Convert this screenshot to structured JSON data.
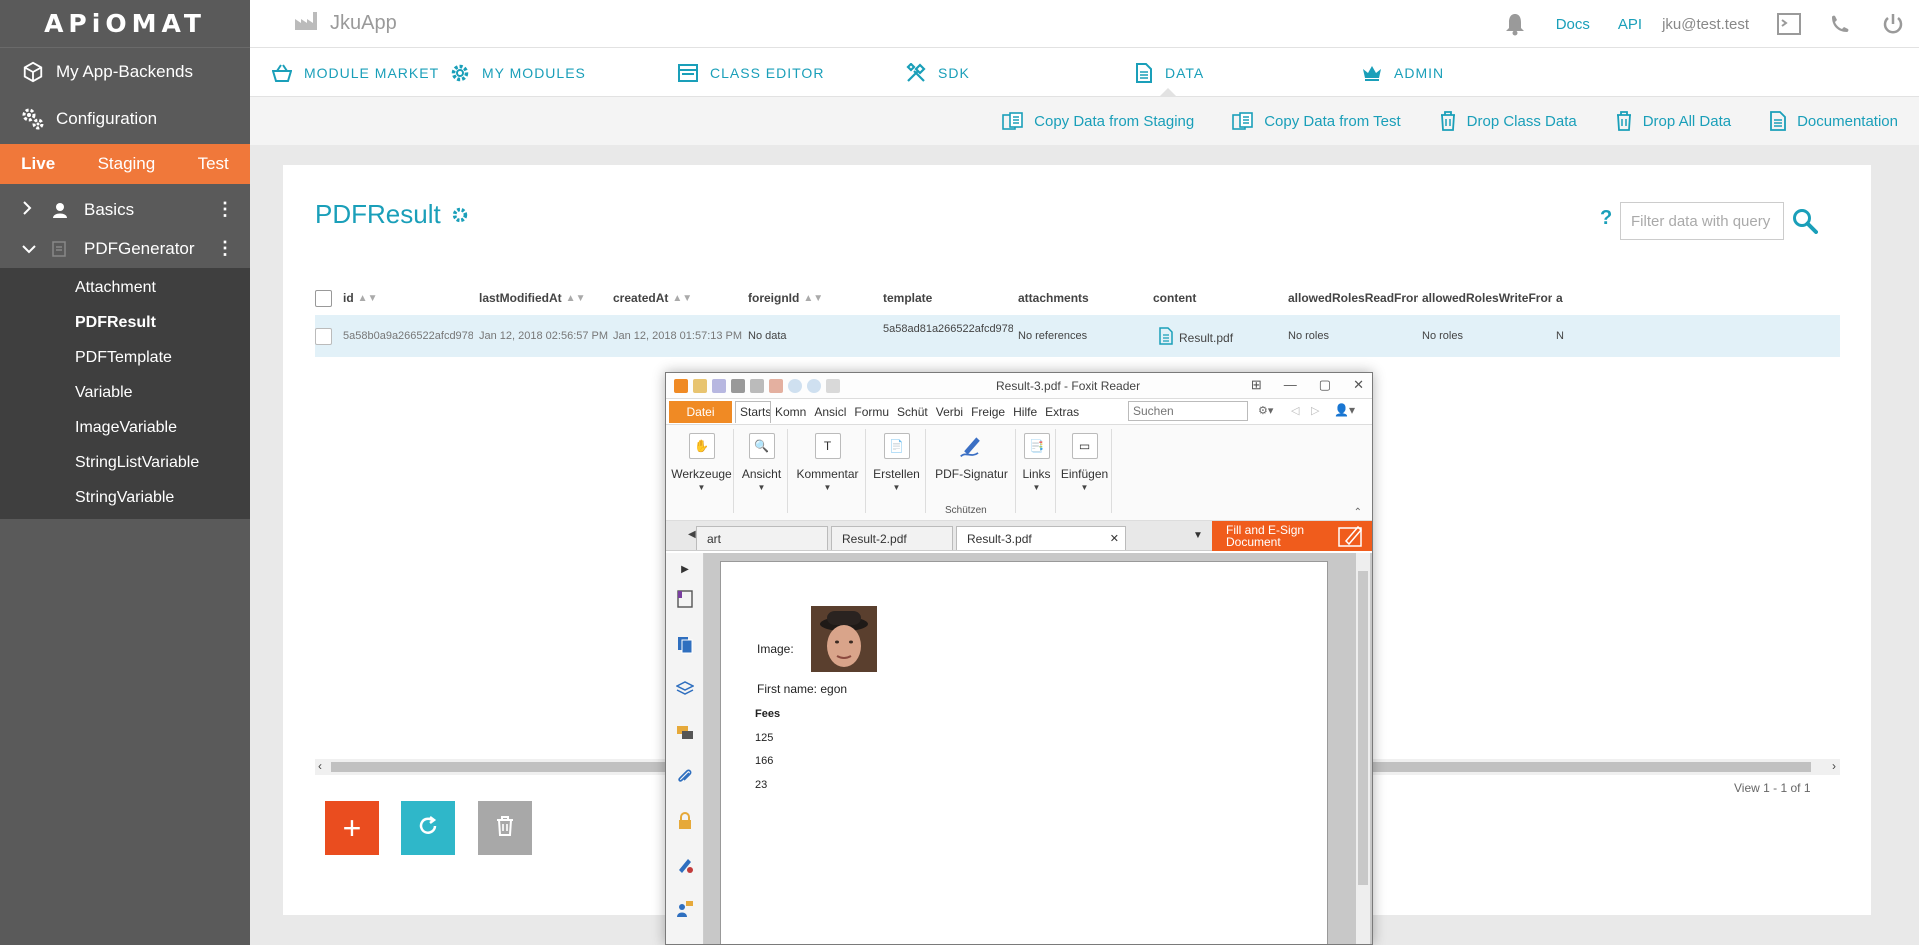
{
  "brand": {
    "logo_text": "APiOMAT",
    "accent": "#1a9fb9",
    "env_color": "#f0783a"
  },
  "topbar": {
    "app_name": "JkuApp",
    "links": {
      "docs": "Docs",
      "api": "API"
    },
    "user": "jku@test.test"
  },
  "sidebar": {
    "nav": {
      "backends": "My App-Backends",
      "configuration": "Configuration"
    },
    "envs": {
      "live": "Live",
      "staging": "Staging",
      "test": "Test"
    },
    "groups": {
      "basics": "Basics",
      "pdfgenerator": "PDFGenerator"
    },
    "classes": [
      "Attachment",
      "PDFResult",
      "PDFTemplate",
      "Variable",
      "ImageVariable",
      "StringListVariable",
      "StringVariable"
    ]
  },
  "modules": {
    "market": "MODULE MARKET",
    "mine": "MY MODULES",
    "class_editor": "CLASS EDITOR",
    "sdk": "SDK",
    "data": "DATA",
    "admin": "ADMIN"
  },
  "actions": {
    "copy_staging": "Copy Data from Staging",
    "copy_test": "Copy Data from Test",
    "drop_class": "Drop Class Data",
    "drop_all": "Drop All Data",
    "documentation": "Documentation"
  },
  "main": {
    "title": "PDFResult",
    "help": "?",
    "filter_placeholder": "Filter data with query",
    "columns": {
      "id": "id",
      "lastModifiedAt": "lastModifiedAt",
      "createdAt": "createdAt",
      "foreignId": "foreignId",
      "template": "template",
      "attachments": "attachments",
      "content": "content",
      "readRoles": "allowedRolesReadFromO",
      "writeRoles": "allowedRolesWriteFromC",
      "more": "a"
    },
    "row": {
      "id": "5a58b0a9a266522afcd978",
      "lastModifiedAt": "Jan 12, 2018 02:56:57 PM",
      "createdAt": "Jan 12, 2018 01:57:13 PM",
      "foreignId": "No data",
      "template": "5a58ad81a266522afcd978",
      "attachments": "No references",
      "content": "Result.pdf",
      "readRoles": "No roles",
      "writeRoles": "No roles",
      "more": "N"
    },
    "view_info": "View 1 - 1 of 1",
    "add_label": "+"
  },
  "foxit": {
    "window_title": "Result-3.pdf - Foxit Reader",
    "menu": {
      "datei": "Datei",
      "tabs": [
        "Starts",
        "Komn",
        "Ansicl",
        "Formu",
        "Schüt",
        "Verbi",
        "Freige",
        "Hilfe",
        "Extras"
      ]
    },
    "search_placeholder": "Suchen",
    "ribbon": {
      "werkzeuge": "Werkzeuge",
      "ansicht": "Ansicht",
      "kommentar": "Kommentar",
      "erstellen": "Erstellen",
      "signatur": "PDF-Signatur",
      "links": "Links",
      "einfuegen": "Einfügen",
      "group_label": "Schützen"
    },
    "doc_tabs": {
      "t1": "art",
      "t2": "Result-2.pdf",
      "t3": "Result-3.pdf"
    },
    "fill_sign": "Fill and E-Sign Document",
    "document": {
      "image_label": "Image:",
      "first_name": "First name: egon",
      "fees_header": "Fees",
      "fees": [
        "125",
        "166",
        "23"
      ]
    }
  }
}
